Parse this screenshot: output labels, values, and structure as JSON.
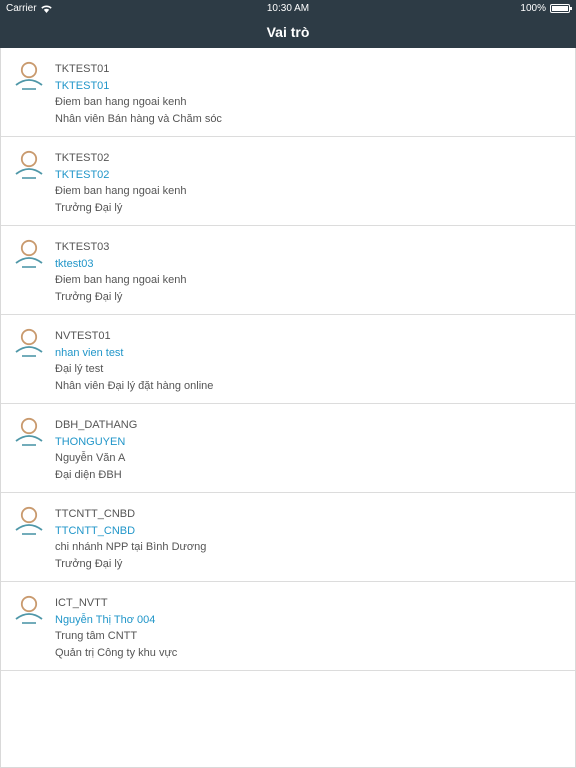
{
  "status_bar": {
    "carrier": "Carrier",
    "time": "10:30 AM",
    "battery": "100%"
  },
  "header": {
    "title": "Vai trò"
  },
  "colors": {
    "header_bg": "#2d3b45",
    "accent": "#2196c9",
    "avatar_head": "#c99a6e",
    "avatar_body": "#4f97a8"
  },
  "items": [
    {
      "code": "TKTEST01",
      "user": "TKTEST01",
      "unit": "Điem ban hang ngoai kenh",
      "role": "Nhân viên Bán hàng và Chăm sóc"
    },
    {
      "code": "TKTEST02",
      "user": "TKTEST02",
      "unit": "Điem ban hang ngoai kenh",
      "role": "Trưởng Đại lý"
    },
    {
      "code": "TKTEST03",
      "user": "tktest03",
      "unit": "Điem ban hang ngoai kenh",
      "role": "Trưởng Đại lý"
    },
    {
      "code": "NVTEST01",
      "user": "nhan vien test",
      "unit": "Đại lý test",
      "role": "Nhân viên Đại lý đặt hàng online"
    },
    {
      "code": "DBH_DATHANG",
      "user": "THONGUYEN",
      "unit": "Nguyễn Văn A",
      "role": "Đại diện ĐBH"
    },
    {
      "code": "TTCNTT_CNBD",
      "user": "TTCNTT_CNBD",
      "unit": "chi nhánh NPP tại Bình Dương",
      "role": "Trưởng Đại lý"
    },
    {
      "code": "ICT_NVTT",
      "user": "Nguyễn Thị Thơ 004",
      "unit": "Trung tâm CNTT",
      "role": "Quản trị Công ty khu vực"
    }
  ]
}
